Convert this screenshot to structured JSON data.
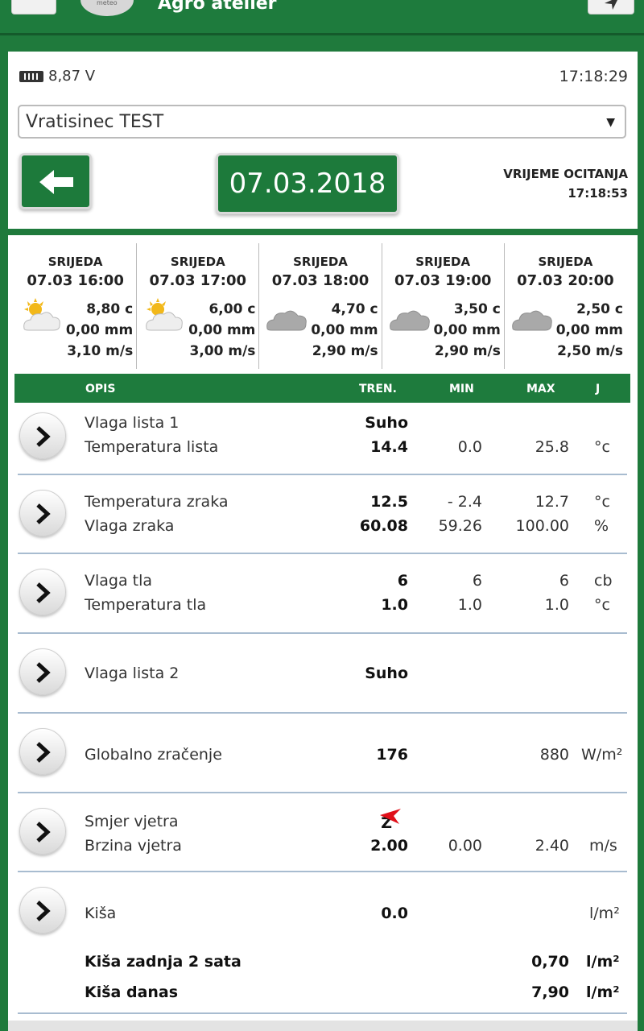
{
  "app": {
    "title": "Agro atelier",
    "logo_text": "meteo"
  },
  "status": {
    "battery": "8,87 V",
    "time": "17:18:29"
  },
  "station": {
    "selected": "Vratisinec TEST"
  },
  "date_label": "07.03.2018",
  "reading": {
    "label": "VRIJEME OCITANJA",
    "time": "17:18:53"
  },
  "forecast": [
    {
      "day": "SRIJEDA",
      "time": "07.03 16:00",
      "temp": "8,80 c",
      "rain": "0,00 mm",
      "wind": "3,10 m/s",
      "icon": "partly-sunny-icon"
    },
    {
      "day": "SRIJEDA",
      "time": "07.03 17:00",
      "temp": "6,00 c",
      "rain": "0,00 mm",
      "wind": "3,00 m/s",
      "icon": "partly-sunny-icon"
    },
    {
      "day": "SRIJEDA",
      "time": "07.03 18:00",
      "temp": "4,70 c",
      "rain": "0,00 mm",
      "wind": "2,90 m/s",
      "icon": "cloud-icon"
    },
    {
      "day": "SRIJEDA",
      "time": "07.03 19:00",
      "temp": "3,50 c",
      "rain": "0,00 mm",
      "wind": "2,90 m/s",
      "icon": "cloud-icon"
    },
    {
      "day": "SRIJEDA",
      "time": "07.03 20:00",
      "temp": "2,50 c",
      "rain": "0,00 mm",
      "wind": "2,50 m/s",
      "icon": "cloud-icon"
    }
  ],
  "table": {
    "headers": {
      "desc": "OPIS",
      "current": "TREN.",
      "min": "MIN",
      "max": "MAX",
      "unit": "J"
    },
    "rows": [
      {
        "lines": [
          {
            "label": "Vlaga lista 1",
            "current": "Suho",
            "min": "",
            "max": "",
            "unit": ""
          },
          {
            "label": "Temperatura lista",
            "current": "14.4",
            "min": "0.0",
            "max": "25.8",
            "unit": "°c"
          }
        ]
      },
      {
        "lines": [
          {
            "label": "Temperatura zraka",
            "current": "12.5",
            "min": "- 2.4",
            "max": "12.7",
            "unit": "°c"
          },
          {
            "label": "Vlaga zraka",
            "current": "60.08",
            "min": "59.26",
            "max": "100.00",
            "unit": "%"
          }
        ]
      },
      {
        "lines": [
          {
            "label": "Vlaga tla",
            "current": "6",
            "min": "6",
            "max": "6",
            "unit": "cb"
          },
          {
            "label": "Temperatura tla",
            "current": "1.0",
            "min": "1.0",
            "max": "1.0",
            "unit": "°c"
          }
        ]
      },
      {
        "lines": [
          {
            "label": "Vlaga lista 2",
            "current": "Suho",
            "min": "",
            "max": "",
            "unit": ""
          }
        ]
      },
      {
        "lines": [
          {
            "label": "Globalno zračenje",
            "current": "176",
            "min": "",
            "max": "880",
            "unit": "W/m²"
          }
        ]
      },
      {
        "lines": [
          {
            "label": "Smjer vjetra",
            "current": "Z",
            "min": "",
            "max": "",
            "unit": ""
          },
          {
            "label": "Brzina vjetra",
            "current": "2.00",
            "min": "0.00",
            "max": "2.40",
            "unit": "m/s"
          }
        ]
      },
      {
        "lines": [
          {
            "label": "Kiša",
            "current": "0.0",
            "min": "",
            "max": "",
            "unit": "l/m²"
          },
          {
            "label": "Kiša zadnja 2 sata",
            "current": "",
            "min": "",
            "max": "0,70",
            "unit": "l/m²"
          },
          {
            "label": "Kiša danas",
            "current": "",
            "min": "",
            "max": "7,90",
            "unit": "l/m²"
          }
        ]
      }
    ]
  },
  "colors": {
    "brand_green": "#1e7b3d",
    "wind_arrow": "#e0101a",
    "divider": "#a8bcd0"
  }
}
